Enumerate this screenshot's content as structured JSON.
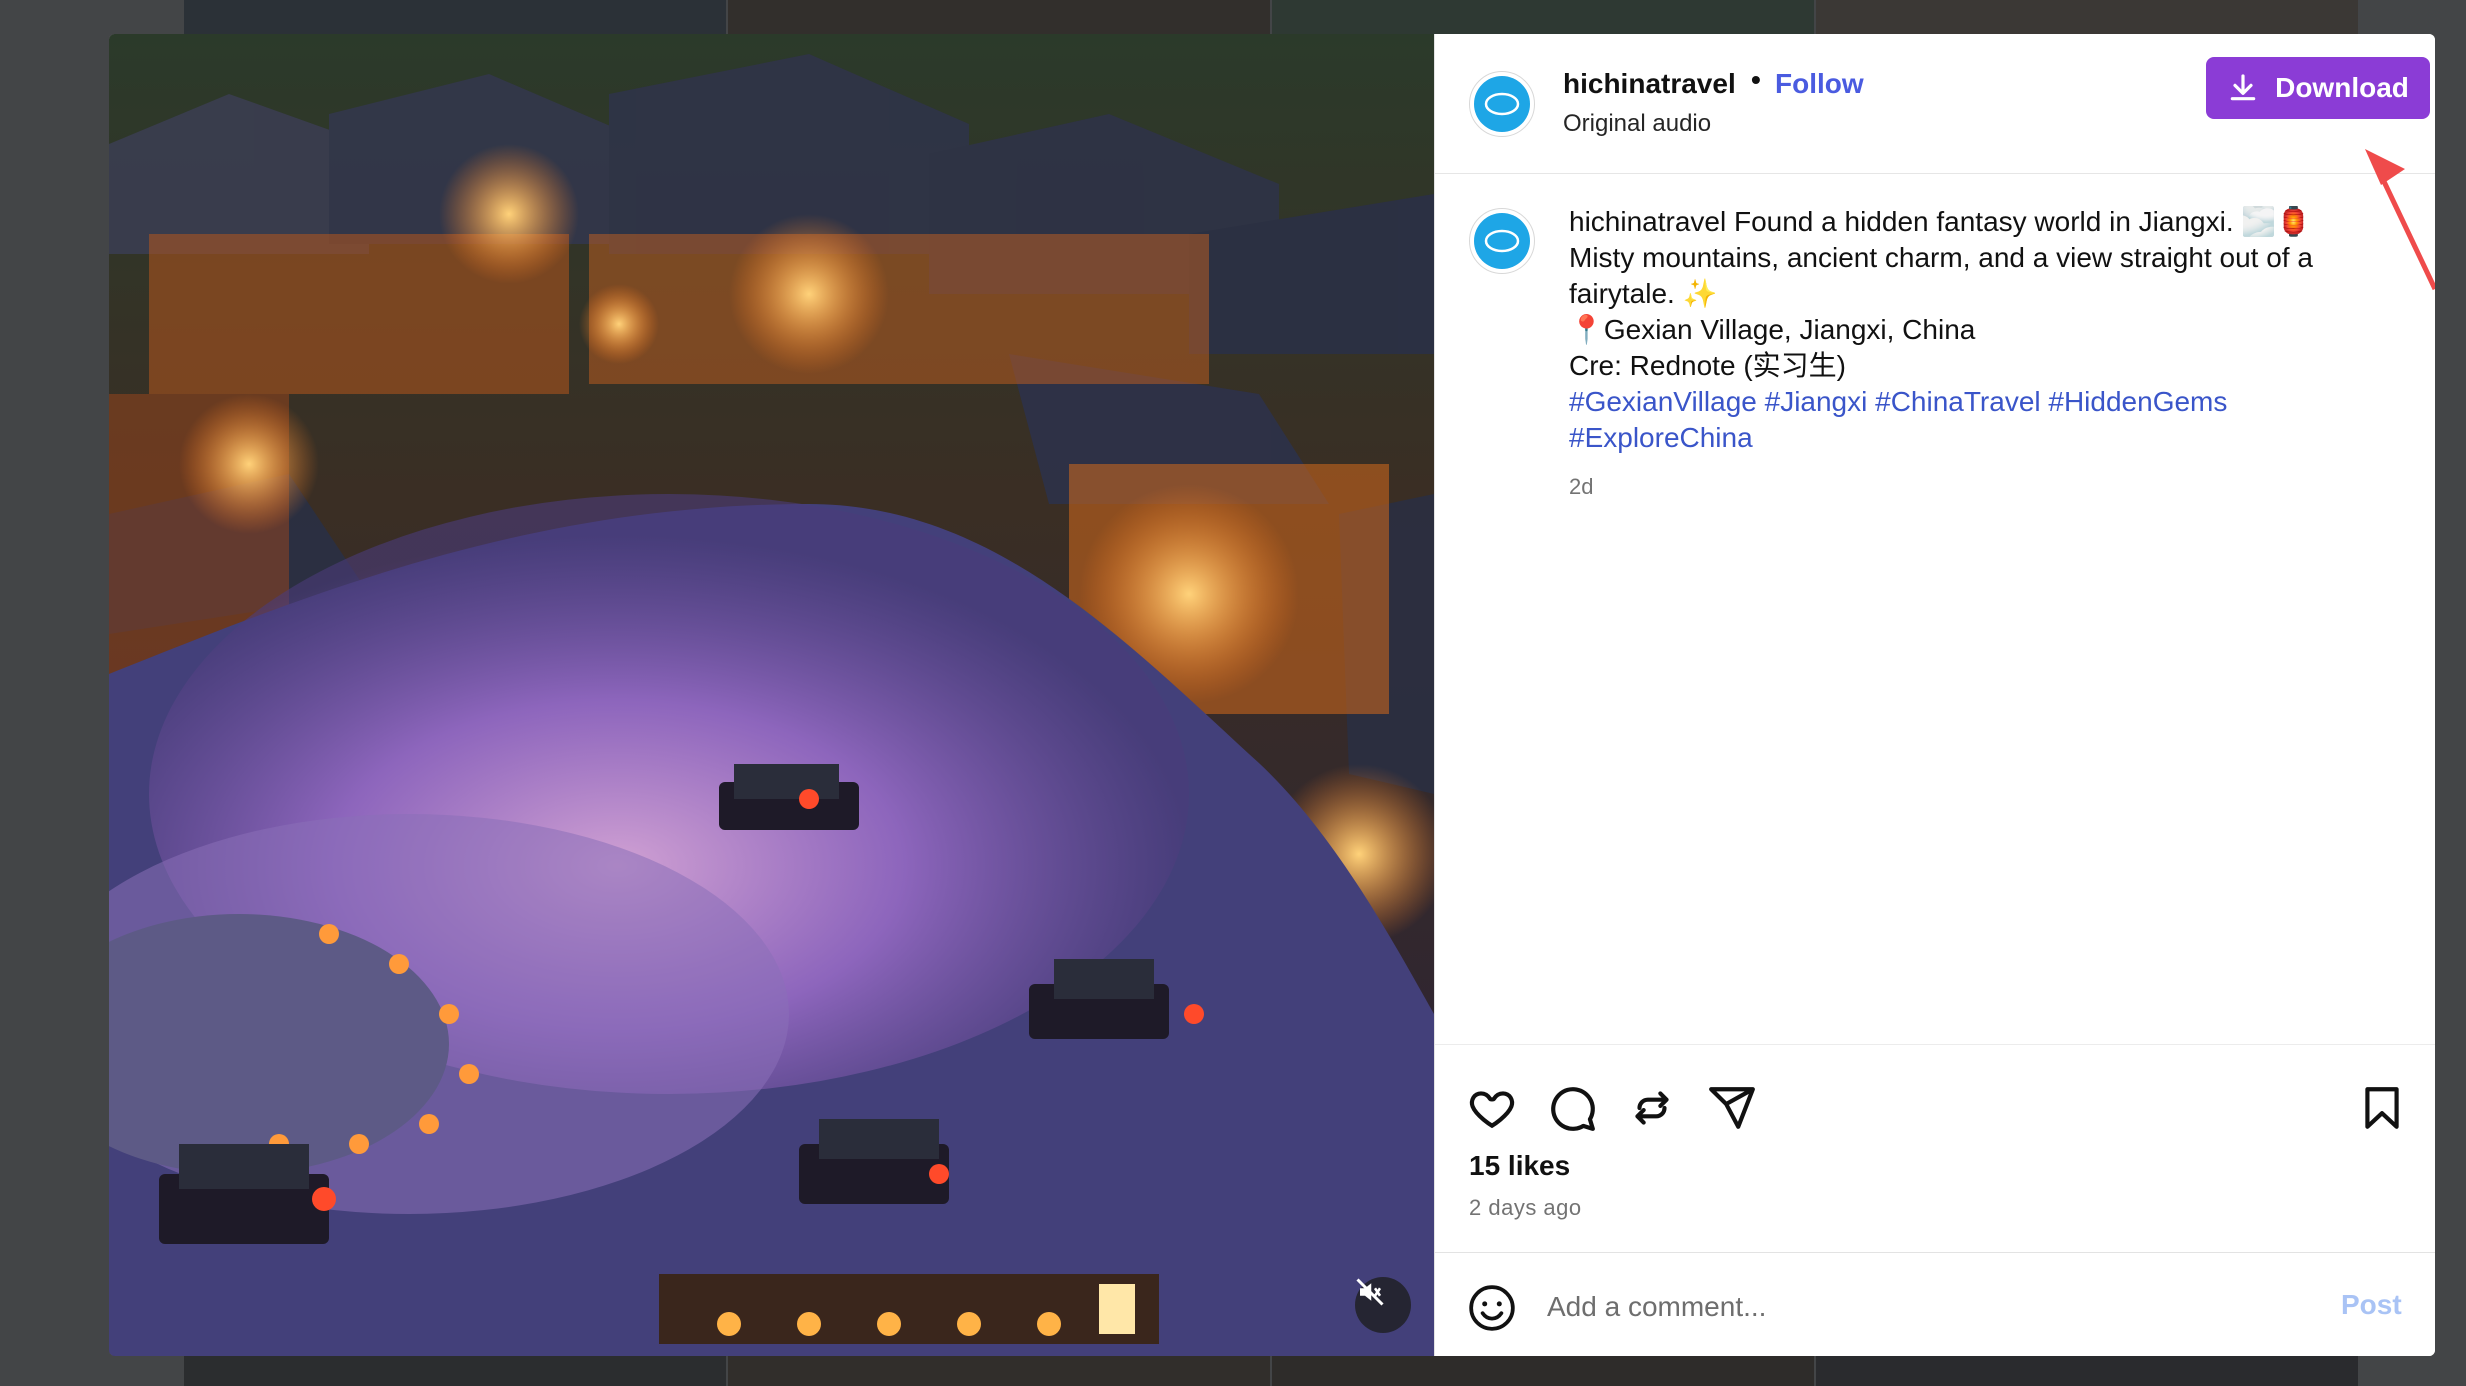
{
  "post": {
    "username": "hichinatravel",
    "separator": "•",
    "follow_label": "Follow",
    "audio": "Original audio",
    "download_label": "Download",
    "caption": {
      "username": "hichinatravel",
      "line1": "Found a hidden fantasy world in Jiangxi. 🌫️🏮",
      "line2": "Misty mountains, ancient charm, and a view straight out of a",
      "line3": "fairytale. ✨",
      "line4": "📍Gexian Village, Jiangxi, China",
      "line5": "Cre: Rednote (实习生)",
      "hashtags_line1": "#GexianVillage #Jiangxi #ChinaTravel #HiddenGems",
      "hashtags_line2": "#ExploreChina"
    },
    "age": "2d",
    "likes": "15 likes",
    "posted": "2 days ago",
    "comment_placeholder": "Add a comment...",
    "post_label": "Post"
  },
  "colors": {
    "accent_download": "#8b3cd6",
    "follow": "#4a5be0",
    "hashtag": "#3a55c9",
    "arrow": "#ef4b4b"
  },
  "icons": [
    "heart-icon",
    "comment-icon",
    "repost-icon",
    "share-icon",
    "bookmark-icon",
    "emoji-icon",
    "mute-icon",
    "download-icon",
    "red-arrow-icon"
  ]
}
